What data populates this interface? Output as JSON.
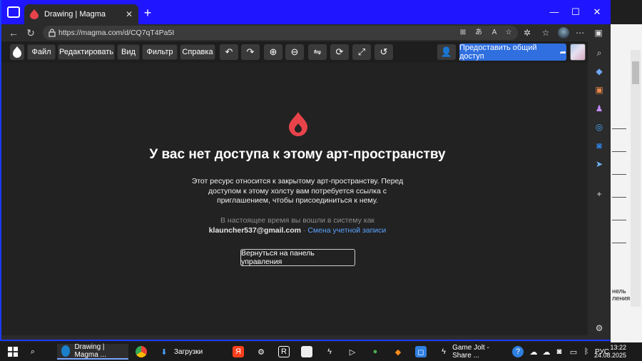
{
  "browser": {
    "tab_title": "Drawing | Magma",
    "tab_close": "✕",
    "new_tab": "+",
    "url": "https://magma.com/d/CQ7qT4Pa5I",
    "window_controls": {
      "minimize": "—",
      "maximize": "☐",
      "close": "✕"
    },
    "accent": "#1f16ff"
  },
  "magma_menu": {
    "file": "Файл",
    "edit": "Редактировать",
    "view": "Вид",
    "filter": "Фильтр",
    "help": "Справка",
    "share": "Предоставить общий доступ",
    "share_color": "#2f6fe0"
  },
  "page": {
    "heading": "У вас нет доступа к этому арт-пространству",
    "description": "Этот ресурс относится к закрытому арт-пространству. Перед доступом к этому холсту вам потребуется ссылка с приглашением, чтобы присоединиться к нему.",
    "signed_in_label": "В настоящее время вы вошли в систему как",
    "email": "klauncher537@gmail.com",
    "separator": "·",
    "switch_account": "Смена учетной записи",
    "back_button": "Вернуться на панель управления",
    "brand_color": "#e8434a"
  },
  "taskbar": {
    "apps": [
      {
        "label": "Drawing | Magma ...",
        "icon": "edge-icon"
      },
      {
        "label": "Загрузки",
        "icon": "download-arrow-icon"
      },
      {
        "label": "Game Jolt - Share ...",
        "icon": "game-jolt-icon"
      }
    ],
    "lang": "РУС",
    "time": "13:22",
    "date": "24.08.2025"
  },
  "background_window": {
    "text_1": "нель",
    "text_2": "ления"
  }
}
